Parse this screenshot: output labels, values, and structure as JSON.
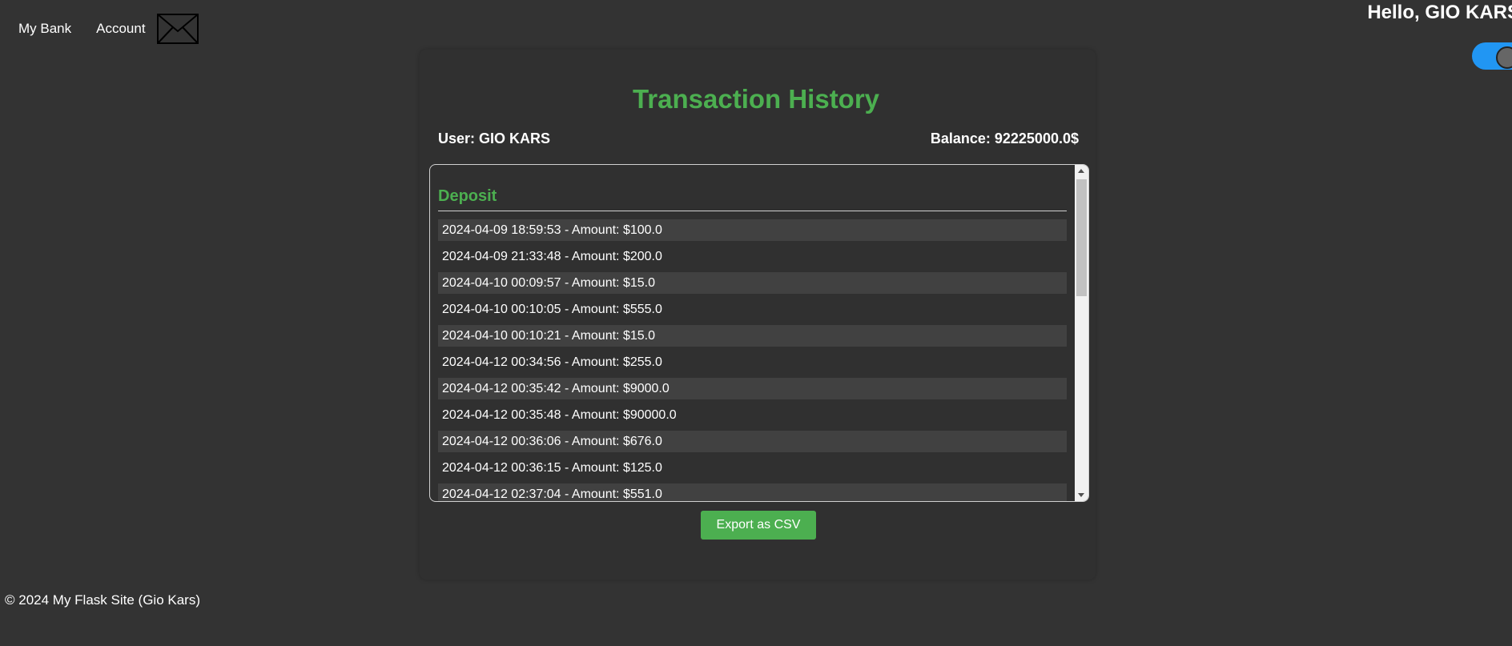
{
  "nav": {
    "items": [
      {
        "label": "My Bank"
      },
      {
        "label": "Account"
      }
    ],
    "mail_icon": "envelope-icon"
  },
  "header": {
    "greeting": "Hello, GIO KARS",
    "theme_toggle_on": true,
    "toggle_color": "#2196f3"
  },
  "main": {
    "title": "Transaction History",
    "user_text": "User: GIO KARS",
    "balance_text": "Balance: 92225000.0$",
    "section_title": "Deposit",
    "transactions": [
      "2024-04-09 18:59:53 - Amount: $100.0",
      "2024-04-09 21:33:48 - Amount: $200.0",
      "2024-04-10 00:09:57 - Amount: $15.0",
      "2024-04-10 00:10:05 - Amount: $555.0",
      "2024-04-10 00:10:21 - Amount: $15.0",
      "2024-04-12 00:34:56 - Amount: $255.0",
      "2024-04-12 00:35:42 - Amount: $9000.0",
      "2024-04-12 00:35:48 - Amount: $90000.0",
      "2024-04-12 00:36:06 - Amount: $676.0",
      "2024-04-12 00:36:15 - Amount: $125.0",
      "2024-04-12 02:37:04 - Amount: $551.0"
    ],
    "export_label": "Export as CSV",
    "accent_color": "#4caf50"
  },
  "footer": {
    "text": "© 2024 My Flask Site (Gio Kars)"
  }
}
